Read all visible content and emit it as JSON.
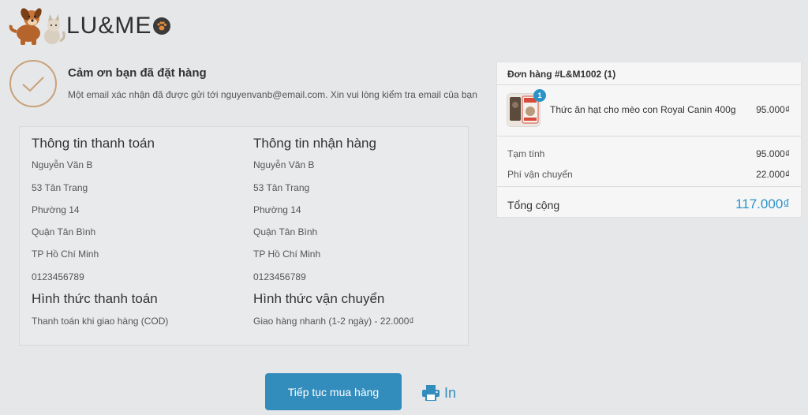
{
  "header": {
    "logo_text": "LU&ME",
    "logo_alt": "LU&MEO"
  },
  "thanks": {
    "title": "Cảm ơn bạn đã đặt hàng",
    "message": "Một email xác nhận đã được gửi tới nguyenvanb@email.com. Xin vui lòng kiểm tra email của bạn"
  },
  "billing": {
    "title": "Thông tin thanh toán",
    "lines": [
      "Nguyễn Văn B",
      "53 Tân Trang",
      "Phường 14",
      "Quận Tân Bình",
      "TP Hồ Chí Minh",
      "0123456789"
    ]
  },
  "shipping": {
    "title": "Thông tin nhận hàng",
    "lines": [
      "Nguyễn Văn B",
      "53 Tân Trang",
      "Phường 14",
      "Quận Tân Bình",
      "TP Hồ Chí Minh",
      "0123456789"
    ]
  },
  "payment_method": {
    "title": "Hình thức thanh toán",
    "value": "Thanh toán khi giao hàng (COD)"
  },
  "shipping_method": {
    "title": "Hình thức vận chuyển",
    "value": "Giao hàng nhanh (1-2 ngày) - 22.000₫"
  },
  "actions": {
    "continue_label": "Tiếp tục mua hàng",
    "print_label": "In"
  },
  "order": {
    "header": "Đơn hàng #L&M1002 (1)",
    "item": {
      "quantity": "1",
      "name": "Thức ăn hạt cho mèo con Royal Canin 400g",
      "price": "95.000₫"
    },
    "subtotal_label": "Tạm tính",
    "subtotal_value": "95.000₫",
    "shipping_label": "Phí vận chuyển",
    "shipping_value": "22.000₫",
    "total_label": "Tổng cộng",
    "total_value": "117.000₫"
  },
  "colors": {
    "accent": "#338dbc",
    "background": "#e6e7e9",
    "check_circle": "#c8a27a"
  },
  "icons": [
    "dog-cat-logo-icon",
    "paw-icon",
    "checkmark-icon",
    "printer-icon",
    "product-thumbnail"
  ]
}
